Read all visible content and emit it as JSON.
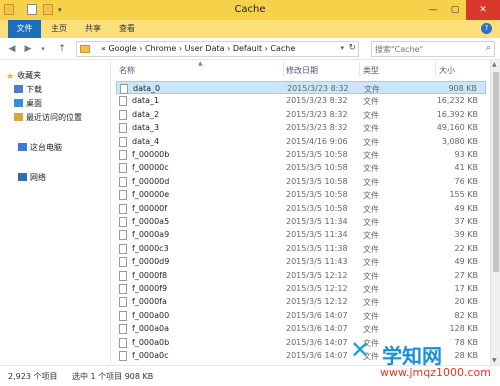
{
  "window": {
    "title": "Cache",
    "controls": [
      "—",
      "▢",
      "✕"
    ]
  },
  "ribbon": {
    "tabs": [
      "文件",
      "主页",
      "共享",
      "查看"
    ],
    "help_label": "?"
  },
  "address": {
    "prefix": "«",
    "segments": [
      "Google",
      "Chrome",
      "User Data",
      "Default",
      "Cache"
    ],
    "separator": "›",
    "search_placeholder": "搜索\"Cache\""
  },
  "nav": {
    "items": [
      {
        "label": "收藏夹",
        "icon": "star-icon"
      },
      {
        "label": "下载",
        "icon": "download-folder-icon"
      },
      {
        "label": "桌面",
        "icon": "desktop-icon"
      },
      {
        "label": "最近访问的位置",
        "icon": "recent-places-icon"
      },
      {
        "label": "这台电脑",
        "icon": "computer-icon"
      },
      {
        "label": "网络",
        "icon": "network-icon"
      }
    ]
  },
  "columns": {
    "name": "名称",
    "date": "修改日期",
    "type": "类型",
    "size": "大小"
  },
  "files": [
    {
      "name": "data_0",
      "date": "2015/3/23 8:32",
      "type": "文件",
      "size": "908 KB",
      "selected": true
    },
    {
      "name": "data_1",
      "date": "2015/3/23 8:32",
      "type": "文件",
      "size": "16,232 KB"
    },
    {
      "name": "data_2",
      "date": "2015/3/23 8:32",
      "type": "文件",
      "size": "16,392 KB"
    },
    {
      "name": "data_3",
      "date": "2015/3/23 8:32",
      "type": "文件",
      "size": "49,160 KB"
    },
    {
      "name": "data_4",
      "date": "2015/4/16 9:06",
      "type": "文件",
      "size": "3,080 KB"
    },
    {
      "name": "f_00000b",
      "date": "2015/3/5 10:58",
      "type": "文件",
      "size": "93 KB"
    },
    {
      "name": "f_00000c",
      "date": "2015/3/5 10:58",
      "type": "文件",
      "size": "41 KB"
    },
    {
      "name": "f_00000d",
      "date": "2015/3/5 10:58",
      "type": "文件",
      "size": "76 KB"
    },
    {
      "name": "f_00000e",
      "date": "2015/3/5 10:58",
      "type": "文件",
      "size": "155 KB"
    },
    {
      "name": "f_00000f",
      "date": "2015/3/5 10:58",
      "type": "文件",
      "size": "49 KB"
    },
    {
      "name": "f_0000a5",
      "date": "2015/3/5 11:34",
      "type": "文件",
      "size": "37 KB"
    },
    {
      "name": "f_0000a9",
      "date": "2015/3/5 11:34",
      "type": "文件",
      "size": "39 KB"
    },
    {
      "name": "f_0000c3",
      "date": "2015/3/5 11:38",
      "type": "文件",
      "size": "22 KB"
    },
    {
      "name": "f_0000d9",
      "date": "2015/3/5 11:43",
      "type": "文件",
      "size": "49 KB"
    },
    {
      "name": "f_0000f8",
      "date": "2015/3/5 12:12",
      "type": "文件",
      "size": "27 KB"
    },
    {
      "name": "f_0000f9",
      "date": "2015/3/5 12:12",
      "type": "文件",
      "size": "17 KB"
    },
    {
      "name": "f_0000fa",
      "date": "2015/3/5 12:12",
      "type": "文件",
      "size": "20 KB"
    },
    {
      "name": "f_000a00",
      "date": "2015/3/6 14:07",
      "type": "文件",
      "size": "82 KB"
    },
    {
      "name": "f_000a0a",
      "date": "2015/3/6 14:07",
      "type": "文件",
      "size": "128 KB"
    },
    {
      "name": "f_000a0b",
      "date": "2015/3/6 14:07",
      "type": "文件",
      "size": "78 KB"
    },
    {
      "name": "f_000a0c",
      "date": "2015/3/6 14:07",
      "type": "文件",
      "size": "28 KB"
    }
  ],
  "status": {
    "item_count": "2,923 个项目",
    "selection": "选中 1 个项目  908 KB"
  },
  "watermark": {
    "brand": "学知网",
    "url": "www.jmqz1000.com"
  },
  "colors": {
    "titlebar": "#f6d24a",
    "ribbon": "#fbe07a",
    "file_tab": "#1d6fbb",
    "selection": "#cde6f7"
  }
}
